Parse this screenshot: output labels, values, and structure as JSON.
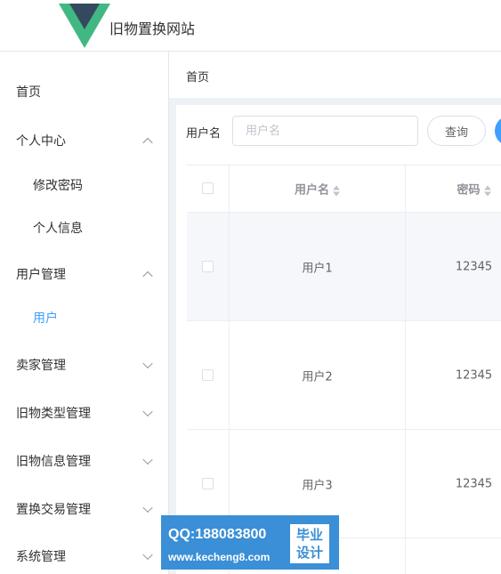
{
  "header": {
    "title": "旧物置换网站",
    "logo": "vue-logo"
  },
  "sidebar": {
    "items": [
      {
        "label": "首页",
        "expandable": false
      },
      {
        "label": "个人中心",
        "expandable": true,
        "expanded": true
      },
      {
        "label": "修改密码",
        "sub": true
      },
      {
        "label": "个人信息",
        "sub": true
      },
      {
        "label": "用户管理",
        "expandable": true,
        "expanded": true
      },
      {
        "label": "用户",
        "sub": true,
        "active": true
      },
      {
        "label": "卖家管理",
        "expandable": true,
        "expanded": false
      },
      {
        "label": "旧物类型管理",
        "expandable": true,
        "expanded": false
      },
      {
        "label": "旧物信息管理",
        "expandable": true,
        "expanded": false
      },
      {
        "label": "置换交易管理",
        "expandable": true,
        "expanded": false
      },
      {
        "label": "系统管理",
        "expandable": true,
        "expanded": false
      }
    ]
  },
  "breadcrumb": "首页",
  "search": {
    "label": "用户名",
    "placeholder": "用户名",
    "button": "查询"
  },
  "table": {
    "columns": [
      "用户名",
      "密码"
    ],
    "rows": [
      {
        "username": "用户1",
        "password": "12345"
      },
      {
        "username": "用户2",
        "password": "12345"
      },
      {
        "username": "用户3",
        "password": "12345"
      }
    ]
  },
  "watermark": {
    "qq": "QQ:188083800",
    "url": "www.kecheng8.com",
    "badge_line1": "毕业",
    "badge_line2": "设计"
  },
  "colors": {
    "accent": "#409eff",
    "logo_green": "#41b883",
    "logo_dark": "#35495e",
    "watermark": "#3a8fd6"
  }
}
